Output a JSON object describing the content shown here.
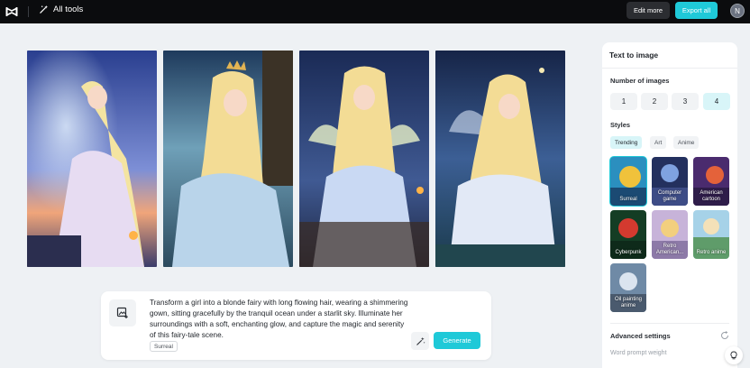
{
  "topbar": {
    "all_tools_label": "All tools",
    "edit_more_label": "Edit more",
    "export_all_label": "Export all",
    "avatar_initial": "N",
    "accent": "#1fc9d8"
  },
  "gallery": {
    "images": [
      {
        "icon": "generated-fairy-image"
      },
      {
        "icon": "generated-fairy-image"
      },
      {
        "icon": "generated-fairy-image"
      },
      {
        "icon": "generated-fairy-image"
      }
    ]
  },
  "prompt": {
    "text": "Transform a girl into a blonde fairy with long flowing hair, wearing a shimmering gown, sitting gracefully by the tranquil ocean under a starlit sky. Illuminate her surroundings with a soft, enchanting glow, and capture the magic and serenity of this fairy-tale scene.",
    "tag": "Surreal",
    "generate_label": "Generate"
  },
  "panel": {
    "title": "Text to image",
    "number_label": "Number of images",
    "numbers": [
      "1",
      "2",
      "3",
      "4"
    ],
    "selected_number": "4",
    "styles_label": "Styles",
    "style_tabs": [
      "Trending",
      "Art",
      "Anime"
    ],
    "selected_tab": "Trending",
    "styles": [
      {
        "label": "Surreal",
        "selected": true
      },
      {
        "label": "Computer game",
        "selected": false
      },
      {
        "label": "American cartoon",
        "selected": false
      },
      {
        "label": "Cyberpunk",
        "selected": false
      },
      {
        "label": "Retro American...",
        "selected": false
      },
      {
        "label": "Retro anime",
        "selected": false
      },
      {
        "label": "Oil painting anime",
        "selected": false
      }
    ],
    "advanced_label": "Advanced settings",
    "word_prompt_label": "Word prompt weight"
  }
}
